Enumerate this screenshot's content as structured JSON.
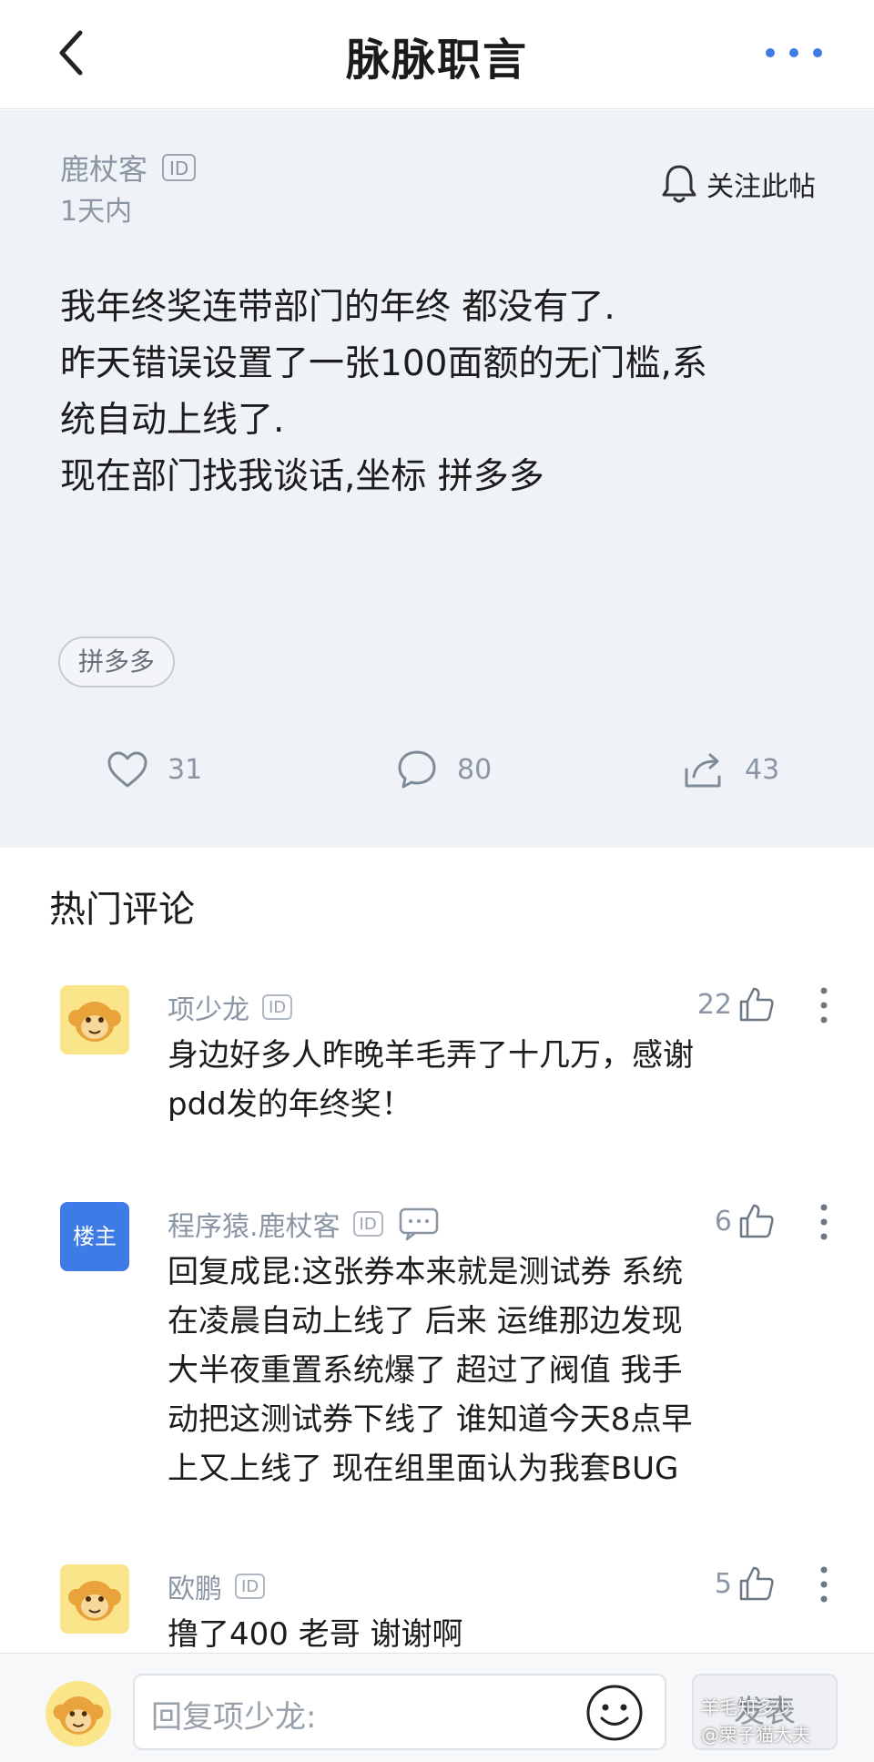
{
  "header": {
    "title": "脉脉职言"
  },
  "post": {
    "author": "鹿杖客",
    "id_badge": "ID",
    "time": "1天内",
    "follow_label": "关注此帖",
    "body_lines": [
      "我年终奖连带部门的年终 都没有了.",
      "昨天错误设置了一张100面额的无门槛,系",
      "统自动上线了.",
      "现在部门找我谈话,坐标 拼多多"
    ],
    "tag": "拼多多",
    "likes": "31",
    "comments": "80",
    "shares": "43"
  },
  "hot_comments": {
    "title": "热门评论",
    "items": [
      {
        "name": "项少龙",
        "id_badge": "ID",
        "likes": "22",
        "lines": [
          "身边好多人昨晚羊毛弄了十几万，感谢",
          "pdd发的年终奖！"
        ]
      },
      {
        "name": "程序猿.鹿杖客",
        "id_badge": "ID",
        "owner_badge": "楼主",
        "likes": "6",
        "lines": [
          "回复成昆:这张券本来就是测试券 系统",
          "在凌晨自动上线了 后来 运维那边发现",
          "大半夜重置系统爆了 超过了阀值  我手",
          "动把这测试券下线了 谁知道今天8点早",
          "上又上线了 现在组里面认为我套BUG"
        ]
      },
      {
        "name": "欧鹏",
        "id_badge": "ID",
        "likes": "5",
        "lines": [
          "撸了400 老哥 谢谢啊"
        ]
      }
    ]
  },
  "reply_bar": {
    "placeholder": "回复项少龙:",
    "send_label": "发表"
  },
  "watermark": {
    "line1": "羊毛知多少",
    "line2": "@栗子猫大夫"
  },
  "colors": {
    "accent": "#3f7be6",
    "post_bg": "#eff2f6",
    "muted_text": "#8b96a4"
  }
}
